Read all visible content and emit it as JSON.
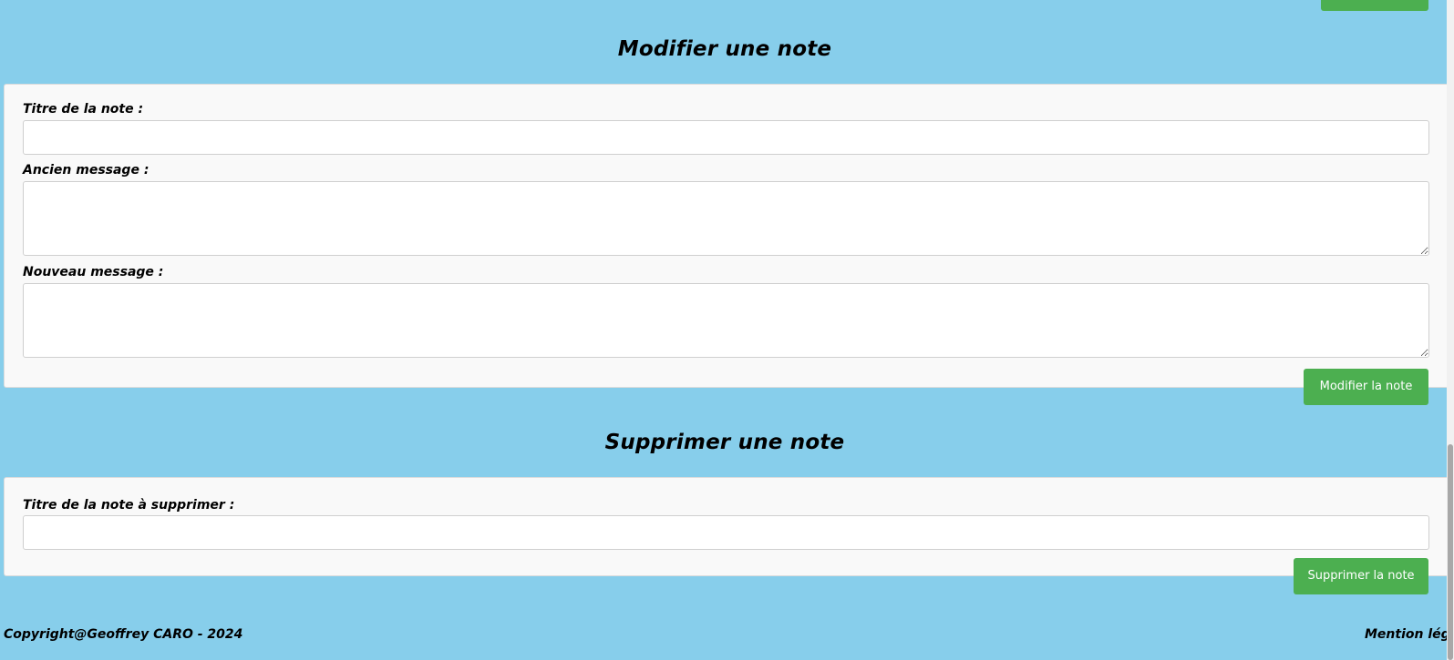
{
  "modify_section": {
    "title": "Modifier une note",
    "title_label": "Titre de la note :",
    "title_value": "",
    "old_message_label": "Ancien message :",
    "old_message_value": "",
    "new_message_label": "Nouveau message :",
    "new_message_value": "",
    "submit_label": "Modifier la note"
  },
  "delete_section": {
    "title": "Supprimer une note",
    "title_label": "Titre de la note à supprimer :",
    "title_value": "",
    "submit_label": "Supprimer la note"
  },
  "footer": {
    "copyright": "Copyright@Geoffrey CARO - 2024",
    "legal_link": "Mention léga"
  },
  "colors": {
    "background": "#87CEEB",
    "card": "#f9f9f9",
    "button": "#4CAF50"
  }
}
